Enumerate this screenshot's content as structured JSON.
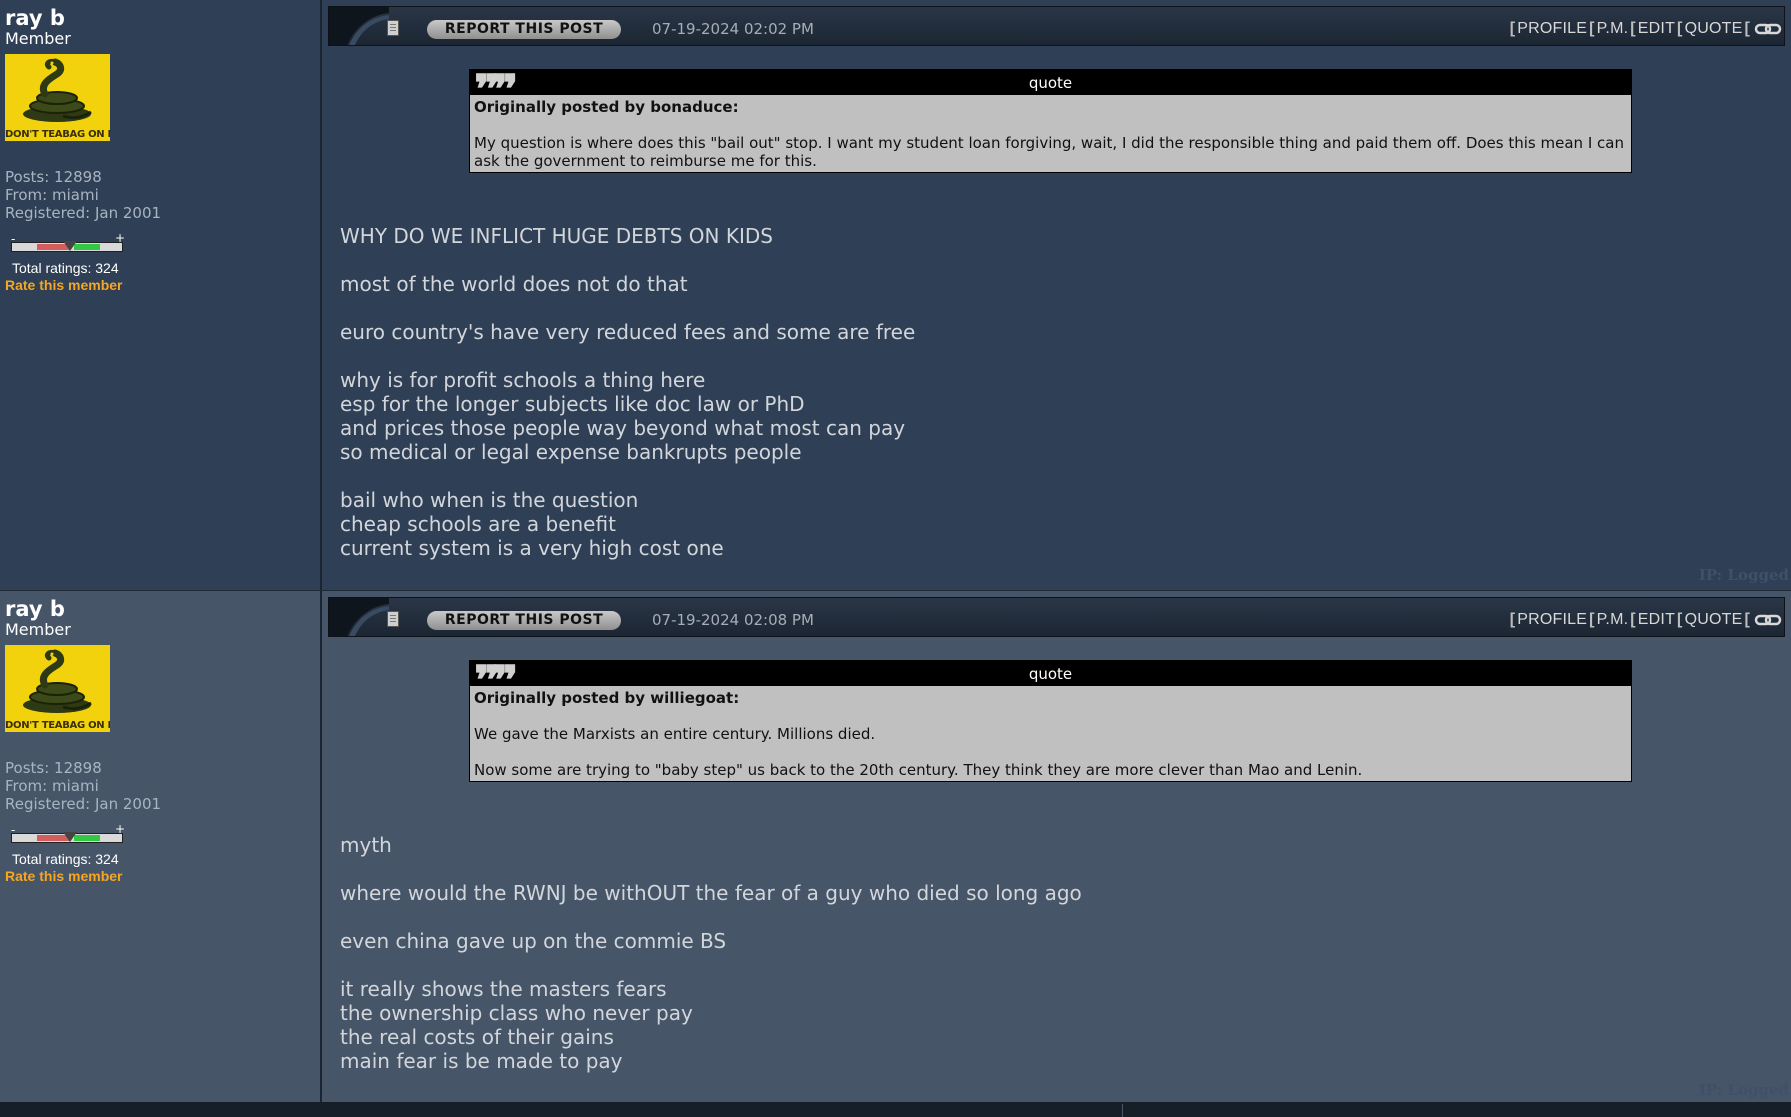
{
  "posts": [
    {
      "author": {
        "name": "ray b",
        "rank": "Member",
        "avatar_text": "DON'T TEABAG ON ME",
        "posts": "Posts: 12898",
        "from": "From: miami",
        "registered": "Registered: Jan 2001",
        "rating_minus": "-",
        "rating_plus": "+",
        "total_ratings": "Total ratings: 324",
        "rate_link": "Rate this member"
      },
      "toolbar": {
        "report_label": "REPORT THIS POST",
        "date": "07-19-2024 02:02 PM",
        "actions": [
          "PROFILE",
          "P.M.",
          "EDIT",
          "QUOTE"
        ]
      },
      "quote": {
        "label": "quote",
        "author_line": "Originally posted by bonaduce:",
        "paragraphs": [
          "My question is where does this \"bail out\" stop. I want my student loan forgiving, wait, I did the responsible thing and paid them off. Does this mean I can ask the government to reimburse me for this."
        ]
      },
      "message": "WHY DO WE INFLICT HUGE DEBTS ON KIDS\n\nmost of the world does not do that\n\neuro country's have very reduced fees and some are free\n\nwhy is for profit schools a thing here\nesp for the longer subjects like doc law or PhD\nand prices those people way beyond what most can pay\nso medical or legal expense bankrupts people\n\nbail who when is the question\ncheap schools are a benefit\ncurrent system is a very high cost one",
      "ip_text": "IP: Logged"
    },
    {
      "author": {
        "name": "ray b",
        "rank": "Member",
        "avatar_text": "DON'T TEABAG ON ME",
        "posts": "Posts: 12898",
        "from": "From: miami",
        "registered": "Registered: Jan 2001",
        "rating_minus": "-",
        "rating_plus": "+",
        "total_ratings": "Total ratings: 324",
        "rate_link": "Rate this member"
      },
      "toolbar": {
        "report_label": "REPORT THIS POST",
        "date": "07-19-2024 02:08 PM",
        "actions": [
          "PROFILE",
          "P.M.",
          "EDIT",
          "QUOTE"
        ]
      },
      "quote": {
        "label": "quote",
        "author_line": "Originally posted by williegoat:",
        "paragraphs": [
          "We gave the Marxists an entire century. Millions died.",
          "Now some are trying to \"baby step\" us back to the 20th century. They think they are more clever than Mao and Lenin."
        ]
      },
      "message": "myth\n\nwhere would the RWNJ be withOUT the fear of a guy who died so long ago\n\neven china gave up on the commie BS\n\nit really shows the masters fears\nthe ownership class who never pay\nthe real costs of their gains\nmain fear is be made to pay",
      "ip_text": "IP: Logged"
    }
  ],
  "colors": {
    "post1_bg": "#2f3f55",
    "post2_bg": "#465568",
    "rate_link": "#f5a623",
    "quote_bg": "#c0c0c0"
  }
}
